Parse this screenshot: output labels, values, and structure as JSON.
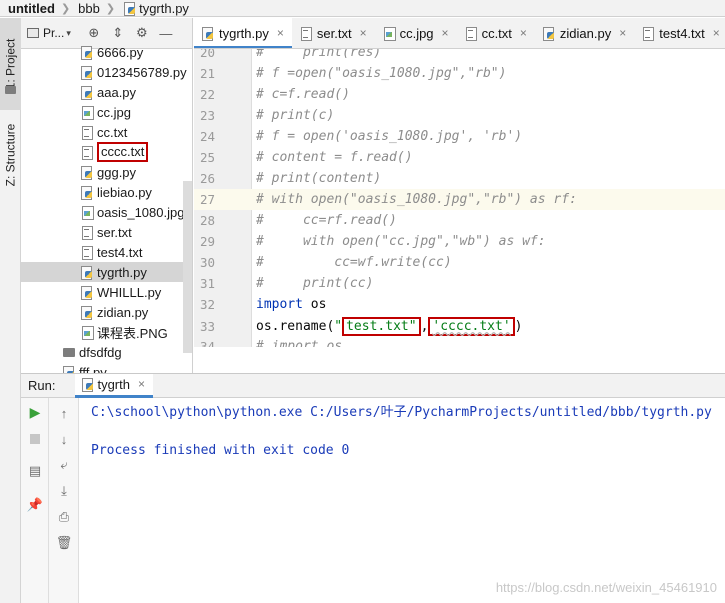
{
  "breadcrumb": {
    "project": "untitled",
    "folder": "bbb",
    "file": "tygrth.py"
  },
  "tool_strip": {
    "project_tab": "1: Project",
    "structure_tab": "Z: Structure"
  },
  "project_panel": {
    "label": "Pr...",
    "tree": [
      {
        "name": "6666.py",
        "type": "py"
      },
      {
        "name": "0123456789.py",
        "type": "py"
      },
      {
        "name": "aaa.py",
        "type": "py"
      },
      {
        "name": "cc.jpg",
        "type": "img"
      },
      {
        "name": "cc.txt",
        "type": "txt"
      },
      {
        "name": "cccc.txt",
        "type": "txt"
      },
      {
        "name": "ggg.py",
        "type": "py"
      },
      {
        "name": "liebiao.py",
        "type": "py"
      },
      {
        "name": "oasis_1080.jpg",
        "type": "img"
      },
      {
        "name": "ser.txt",
        "type": "txt"
      },
      {
        "name": "test4.txt",
        "type": "txt"
      },
      {
        "name": "tygrth.py",
        "type": "py"
      },
      {
        "name": "WHILLL.py",
        "type": "py"
      },
      {
        "name": "zidian.py",
        "type": "py"
      },
      {
        "name": "课程表.PNG",
        "type": "img"
      },
      {
        "name": "dfsdfdg",
        "type": "dir"
      },
      {
        "name": "fff.py",
        "type": "py"
      }
    ]
  },
  "editor_tabs": [
    {
      "label": "tygrth.py",
      "type": "py"
    },
    {
      "label": "ser.txt",
      "type": "txt"
    },
    {
      "label": "cc.jpg",
      "type": "img"
    },
    {
      "label": "cc.txt",
      "type": "txt"
    },
    {
      "label": "zidian.py",
      "type": "py"
    },
    {
      "label": "test4.txt",
      "type": "txt"
    }
  ],
  "code": {
    "lines": [
      {
        "n": "20",
        "text": "#     print(res)"
      },
      {
        "n": "21",
        "text": "# f =open(\"oasis_1080.jpg\",\"rb\")"
      },
      {
        "n": "22",
        "text": "# c=f.read()"
      },
      {
        "n": "23",
        "text": "# print(c)"
      },
      {
        "n": "24",
        "text": "# f = open('oasis_1080.jpg', 'rb')"
      },
      {
        "n": "25",
        "text": "# content = f.read()"
      },
      {
        "n": "26",
        "text": "# print(content)"
      },
      {
        "n": "27",
        "text": "# with open(\"oasis_1080.jpg\",\"rb\") as rf:"
      },
      {
        "n": "28",
        "text": "#     cc=rf.read()"
      },
      {
        "n": "29",
        "text": "#     with open(\"cc.jpg\",\"wb\") as wf:"
      },
      {
        "n": "30",
        "text": "#         cc=wf.write(cc)"
      },
      {
        "n": "31",
        "text": "#     print(cc)"
      },
      {
        "n": "32",
        "text": ""
      },
      {
        "n": "33",
        "text": ""
      },
      {
        "n": "34",
        "text": "# import os"
      }
    ],
    "import_kw": "import",
    "import_mod": " os",
    "rename_call": "os.rename(",
    "quote1": "\"",
    "arg1": "test.txt\"",
    "comma": ",",
    "arg2": "'cccc.txt'",
    "close_paren": ")"
  },
  "run_panel": {
    "label": "Run:",
    "tab": "tygrth",
    "command": "C:\\school\\python\\python.exe C:/Users/叶子/PycharmProjects/untitled/bbb/tygrth.py",
    "exit_message": "Process finished with exit code 0"
  },
  "watermark": "https://blog.csdn.net/weixin_45461910"
}
